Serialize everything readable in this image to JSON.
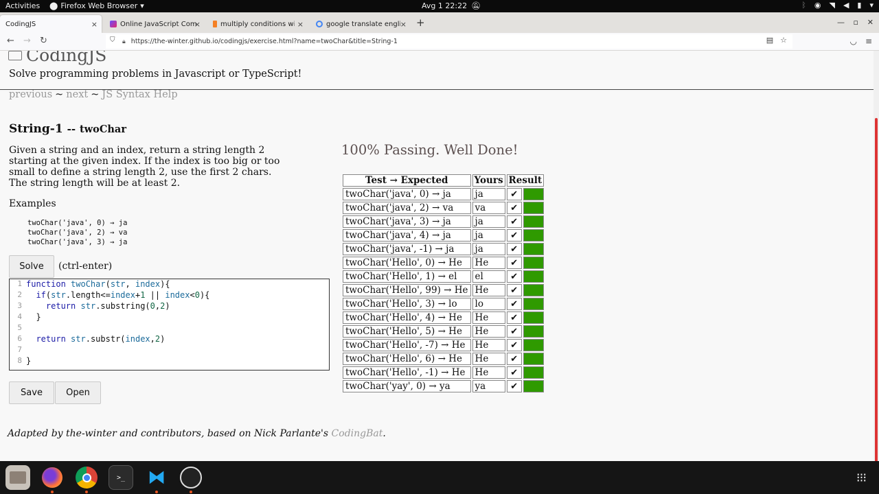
{
  "topbar": {
    "activities": "Activities",
    "app_name": "Firefox Web Browser",
    "clock": "Avg 1  22:22"
  },
  "tabs": [
    {
      "label": "CodingJS",
      "active": true
    },
    {
      "label": "Online JavaScript Compil",
      "active": false
    },
    {
      "label": "multiply conditions with",
      "active": false
    },
    {
      "label": "google translate english",
      "active": false
    }
  ],
  "url": "https://the-winter.github.io/codingjs/exercise.html?name=twoChar&title=String-1",
  "page": {
    "logo": "CodingJS",
    "tagline": "Solve programming problems in Javascript or TypeScript!",
    "nav": {
      "previous": "previous",
      "next": "next",
      "help": "JS Syntax Help",
      "sep": "~"
    },
    "title_set": "String-1",
    "title_sep": "--",
    "title_fn": "twoChar",
    "description": "Given a string and an index, return a string length 2 starting at the given index. If the index is too big or too small to define a string length 2, use the first 2 chars. The string length will be at least 2.",
    "examples_heading": "Examples",
    "examples": "twoChar('java', 0) → ja\ntwoChar('java', 2) → va\ntwoChar('java', 3) → ja",
    "solve_label": "Solve",
    "solve_hint": "(ctrl-enter)",
    "save_label": "Save",
    "open_label": "Open",
    "footer_text": "Adapted by the-winter and contributors, based on Nick Parlante's ",
    "footer_link": "CodingBat",
    "footer_end": "."
  },
  "editor": {
    "line_numbers": [
      "1",
      "2",
      "3",
      "4",
      "5",
      "6",
      "7",
      "8"
    ]
  },
  "results": {
    "status": "100% Passing. Well Done!",
    "headers": [
      "Test → Expected",
      "Yours",
      "Result"
    ],
    "pass_mark": "✔",
    "pass_color": "#2f9a00",
    "rows": [
      {
        "test": "twoChar('java', 0) → ja",
        "yours": "ja"
      },
      {
        "test": "twoChar('java', 2) → va",
        "yours": "va"
      },
      {
        "test": "twoChar('java', 3) → ja",
        "yours": "ja"
      },
      {
        "test": "twoChar('java', 4) → ja",
        "yours": "ja"
      },
      {
        "test": "twoChar('java', -1) → ja",
        "yours": "ja"
      },
      {
        "test": "twoChar('Hello', 0) → He",
        "yours": "He"
      },
      {
        "test": "twoChar('Hello', 1) → el",
        "yours": "el"
      },
      {
        "test": "twoChar('Hello', 99) → He",
        "yours": "He"
      },
      {
        "test": "twoChar('Hello', 3) → lo",
        "yours": "lo"
      },
      {
        "test": "twoChar('Hello', 4) → He",
        "yours": "He"
      },
      {
        "test": "twoChar('Hello', 5) → He",
        "yours": "He"
      },
      {
        "test": "twoChar('Hello', -7) → He",
        "yours": "He"
      },
      {
        "test": "twoChar('Hello', 6) → He",
        "yours": "He"
      },
      {
        "test": "twoChar('Hello', -1) → He",
        "yours": "He"
      },
      {
        "test": "twoChar('yay', 0) → ya",
        "yours": "ya"
      }
    ]
  },
  "dock": [
    "files-icon",
    "firefox-icon",
    "chrome-icon",
    "terminal-icon",
    "vscode-icon",
    "obs-icon",
    "app-grid-icon"
  ]
}
